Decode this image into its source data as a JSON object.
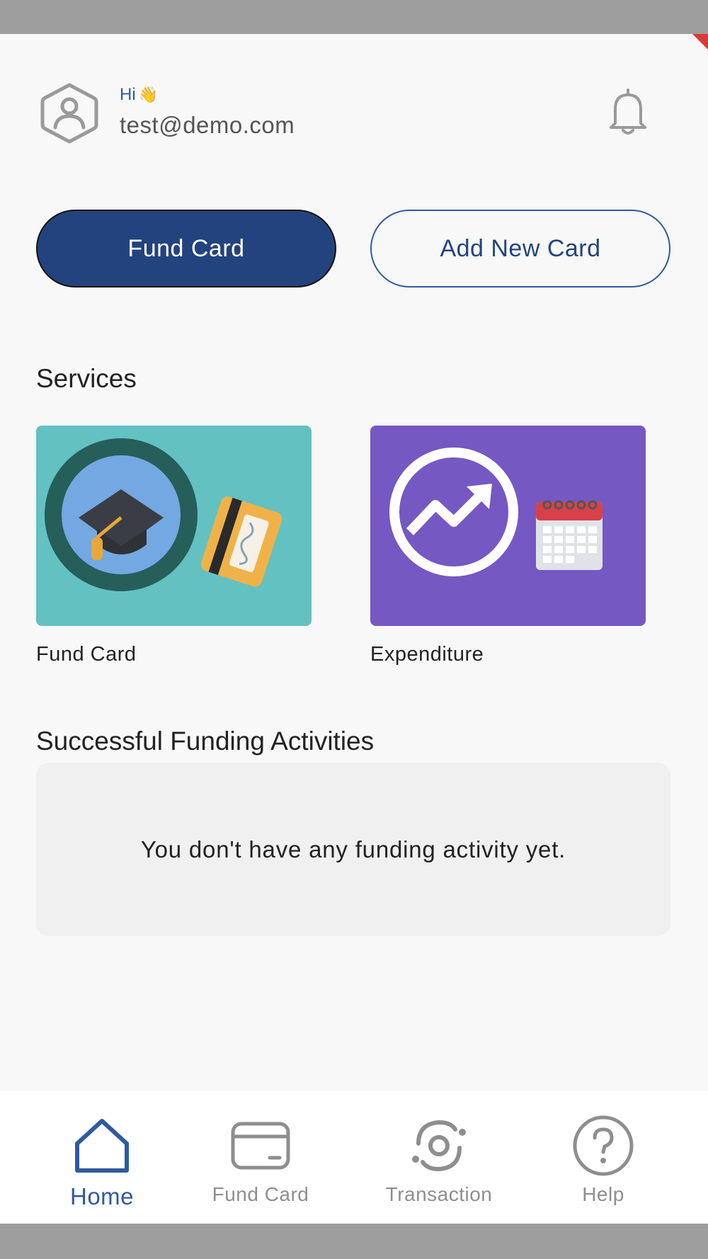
{
  "header": {
    "greeting": "Hi",
    "wave_emoji": "👋",
    "email": "test@demo.com"
  },
  "actions": {
    "fund_card_label": "Fund Card",
    "add_card_label": "Add New Card"
  },
  "services": {
    "title": "Services",
    "items": [
      {
        "label": "Fund Card",
        "icon": "graduation-cap-card-icon",
        "color": "#63c1c2"
      },
      {
        "label": "Expenditure",
        "icon": "trend-calendar-icon",
        "color": "#7558c2"
      }
    ]
  },
  "activities": {
    "title": "Successful Funding Activities",
    "empty_text": "You don't have any funding activity yet."
  },
  "nav": {
    "items": [
      {
        "label": "Home",
        "icon": "home-icon",
        "active": true
      },
      {
        "label": "Fund Card",
        "icon": "card-icon",
        "active": false
      },
      {
        "label": "Transaction",
        "icon": "transaction-icon",
        "active": false
      },
      {
        "label": "Help",
        "icon": "help-icon",
        "active": false
      }
    ]
  },
  "colors": {
    "primary": "#23437e",
    "accent": "#2f5aa0",
    "inactive": "#8e8e8e"
  }
}
